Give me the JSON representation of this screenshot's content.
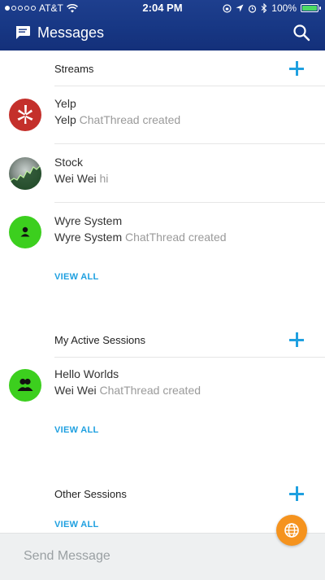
{
  "status_bar": {
    "carrier": "AT&T",
    "time": "2:04 PM",
    "battery": "100%",
    "battery_level": 1.0,
    "signal_dots_filled": 1
  },
  "header": {
    "title": "Messages",
    "chat_icon": "chat-bubble-icon",
    "search_icon": "search-icon"
  },
  "sections": {
    "streams": {
      "label": "Streams",
      "view_all": "VIEW ALL",
      "items": [
        {
          "name": "Yelp",
          "sender": "Yelp",
          "message": "ChatThread created",
          "avatar": "yelp-logo"
        },
        {
          "name": "Stock",
          "sender": "Wei Wei",
          "message": "hi",
          "avatar": "stock-chart"
        },
        {
          "name": "Wyre System",
          "sender": "Wyre System",
          "message": "ChatThread created",
          "avatar": "person-icon"
        }
      ]
    },
    "active": {
      "label": "My Active Sessions",
      "view_all": "VIEW ALL",
      "items": [
        {
          "name": "Hello Worlds",
          "sender": "Wei Wei",
          "message": "ChatThread created",
          "avatar": "group-icon"
        }
      ]
    },
    "other": {
      "label": "Other Sessions",
      "view_all": "VIEW ALL"
    }
  },
  "composer": {
    "placeholder": "Send Message"
  },
  "colors": {
    "header": "#173784",
    "accent": "#1fa0e0",
    "fab": "#f5931e",
    "yelp": "#c4302b",
    "green_avatar": "#3ccf1e"
  }
}
